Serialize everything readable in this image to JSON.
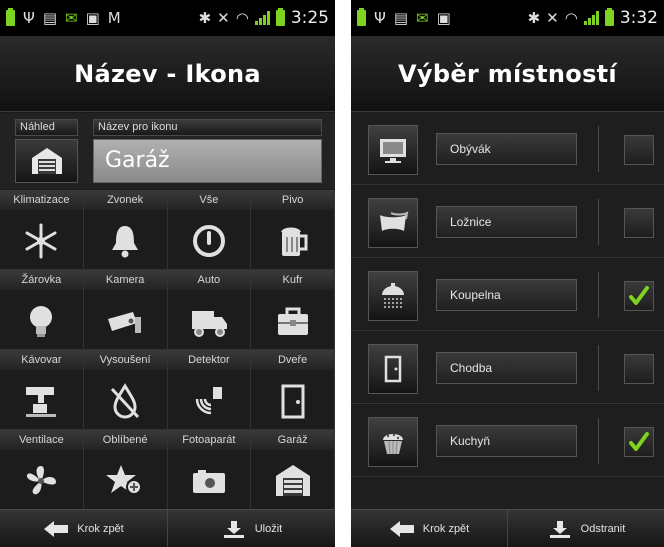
{
  "left": {
    "status": {
      "time": "3:25",
      "icons": [
        "battery-icon",
        "usb-icon",
        "sd-card-icon",
        "mail-icon",
        "image-icon",
        "gmail-icon"
      ],
      "right_icons": [
        "bluetooth-icon",
        "mute-icon",
        "wifi-icon",
        "signal-icon",
        "battery-icon"
      ]
    },
    "title": "Název - Ikona",
    "preview_label": "Náhled",
    "name_label": "Název pro ikonu",
    "name_value": "Garáž",
    "preview_icon": "garage-icon",
    "grid": [
      {
        "label": "Klimatizace",
        "icon": "snowflake-icon"
      },
      {
        "label": "Zvonek",
        "icon": "bell-icon"
      },
      {
        "label": "Vše",
        "icon": "power-icon"
      },
      {
        "label": "Pivo",
        "icon": "beer-icon"
      },
      {
        "label": "Žárovka",
        "icon": "lightbulb-icon"
      },
      {
        "label": "Kamera",
        "icon": "camera-cctv-icon"
      },
      {
        "label": "Auto",
        "icon": "truck-icon"
      },
      {
        "label": "Kufr",
        "icon": "suitcase-icon"
      },
      {
        "label": "Kávovar",
        "icon": "coffee-machine-icon"
      },
      {
        "label": "Vysoušení",
        "icon": "no-drop-icon"
      },
      {
        "label": "Detektor",
        "icon": "sensor-icon"
      },
      {
        "label": "Dveře",
        "icon": "door-icon"
      },
      {
        "label": "Ventilace",
        "icon": "fan-icon"
      },
      {
        "label": "Oblíbené",
        "icon": "star-add-icon"
      },
      {
        "label": "Fotoaparát",
        "icon": "photo-camera-icon"
      },
      {
        "label": "Garáž",
        "icon": "garage-icon"
      }
    ],
    "bottom": {
      "back_label": "Krok zpět",
      "save_label": "Uložit"
    }
  },
  "right": {
    "status": {
      "time": "3:32"
    },
    "title": "Výběr místností",
    "rooms": [
      {
        "name": "Obývák",
        "icon": "tv-icon",
        "checked": false
      },
      {
        "name": "Ložnice",
        "icon": "pillow-icon",
        "checked": false
      },
      {
        "name": "Koupelna",
        "icon": "shower-icon",
        "checked": true
      },
      {
        "name": "Chodba",
        "icon": "door-icon",
        "checked": false
      },
      {
        "name": "Kuchyň",
        "icon": "cupcake-icon",
        "checked": true
      }
    ],
    "bottom": {
      "back_label": "Krok zpět",
      "delete_label": "Odstranit"
    }
  },
  "colors": {
    "check": "#7ed321",
    "accent": "#7ed321"
  }
}
